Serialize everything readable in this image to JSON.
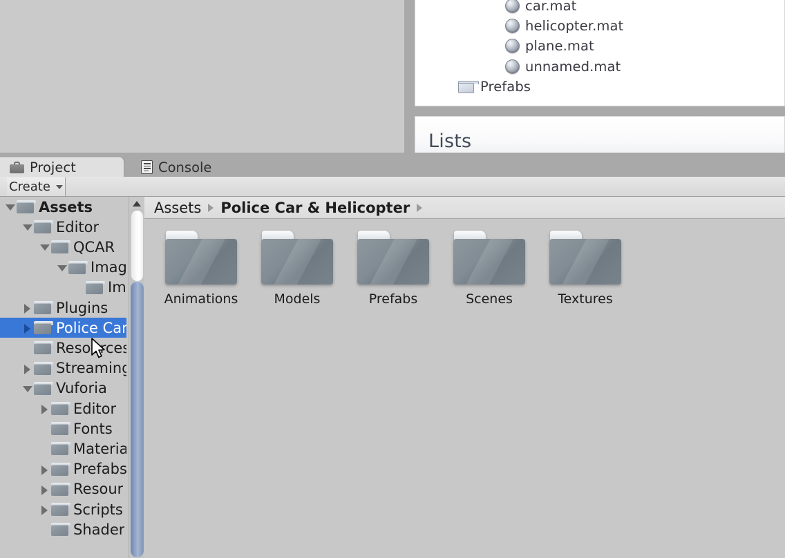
{
  "inspector": {
    "assets": [
      {
        "icon": "material-sphere-icon",
        "label": "car.mat"
      },
      {
        "icon": "material-sphere-icon",
        "label": "helicopter.mat"
      },
      {
        "icon": "material-sphere-icon",
        "label": "plane.mat"
      },
      {
        "icon": "material-sphere-icon",
        "label": "unnamed.mat"
      },
      {
        "icon": "folder-icon",
        "label": "Prefabs"
      }
    ],
    "lists_title": "Lists"
  },
  "project_window": {
    "tabs": [
      {
        "label": "Project",
        "icon": "project-icon",
        "active": true
      },
      {
        "label": "Console",
        "icon": "console-icon",
        "active": false
      }
    ],
    "toolbar": {
      "create_label": "Create",
      "create_caret": "chevron-down-icon"
    },
    "tree": {
      "items": [
        {
          "label": "Assets",
          "depth": 0,
          "arrow": "down",
          "bold": true,
          "selected": false
        },
        {
          "label": "Editor",
          "depth": 1,
          "arrow": "down",
          "bold": false,
          "selected": false
        },
        {
          "label": "QCAR",
          "depth": 2,
          "arrow": "down",
          "bold": false,
          "selected": false
        },
        {
          "label": "Imag",
          "depth": 3,
          "arrow": "down",
          "bold": false,
          "selected": false
        },
        {
          "label": "Im",
          "depth": 4,
          "arrow": "none",
          "bold": false,
          "selected": false
        },
        {
          "label": "Plugins",
          "depth": 1,
          "arrow": "right",
          "bold": false,
          "selected": false
        },
        {
          "label": "Police Car",
          "depth": 1,
          "arrow": "right",
          "bold": false,
          "selected": true
        },
        {
          "label": "Resources",
          "depth": 1,
          "arrow": "none",
          "bold": false,
          "selected": false
        },
        {
          "label": "Streaming",
          "depth": 1,
          "arrow": "right",
          "bold": false,
          "selected": false
        },
        {
          "label": "Vuforia",
          "depth": 1,
          "arrow": "down",
          "bold": false,
          "selected": false
        },
        {
          "label": "Editor",
          "depth": 2,
          "arrow": "right",
          "bold": false,
          "selected": false
        },
        {
          "label": "Fonts",
          "depth": 2,
          "arrow": "none",
          "bold": false,
          "selected": false
        },
        {
          "label": "Materia",
          "depth": 2,
          "arrow": "none",
          "bold": false,
          "selected": false
        },
        {
          "label": "Prefabs",
          "depth": 2,
          "arrow": "right",
          "bold": false,
          "selected": false
        },
        {
          "label": "Resour",
          "depth": 2,
          "arrow": "right",
          "bold": false,
          "selected": false
        },
        {
          "label": "Scripts",
          "depth": 2,
          "arrow": "right",
          "bold": false,
          "selected": false
        },
        {
          "label": "Shader",
          "depth": 2,
          "arrow": "none",
          "bold": false,
          "selected": false
        }
      ]
    },
    "breadcrumb": [
      {
        "label": "Assets",
        "strong": false
      },
      {
        "label": "Police Car & Helicopter",
        "strong": true
      }
    ],
    "grid": {
      "items": [
        {
          "label": "Animations",
          "icon": "folder-icon"
        },
        {
          "label": "Models",
          "icon": "folder-icon"
        },
        {
          "label": "Prefabs",
          "icon": "folder-icon"
        },
        {
          "label": "Scenes",
          "icon": "folder-icon"
        },
        {
          "label": "Textures",
          "icon": "folder-icon"
        }
      ]
    }
  },
  "colors": {
    "window_background": "#c8c8c8",
    "selection_blue": "#3a78d8",
    "toolbar_grey": "#e0e0e0",
    "tabbar_grey": "#a9a9a9",
    "scrollbar_thumb": "#8ba0c2"
  },
  "cursor": {
    "type": "arrow-pointer"
  }
}
